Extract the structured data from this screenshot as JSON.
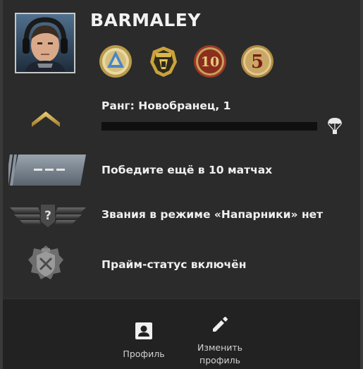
{
  "profile": {
    "username": "BARMALEY"
  },
  "medals": [
    {
      "name": "service-medal-icon"
    },
    {
      "name": "operation-coin-icon"
    },
    {
      "name": "ten-year-coin-icon"
    },
    {
      "name": "five-year-coin-icon"
    }
  ],
  "rank": {
    "label": "Ранг: Новобранец, 1",
    "xp_progress": 0
  },
  "rows": {
    "wins_needed": "Победите ещё в 10 матчах",
    "wingman_rank": "Звания в режиме «Напарники» нет",
    "prime_status": "Прайм-статус включён"
  },
  "footer": {
    "profile_label": "Профиль",
    "edit_label_line1": "Изменить",
    "edit_label_line2": "профиль"
  }
}
